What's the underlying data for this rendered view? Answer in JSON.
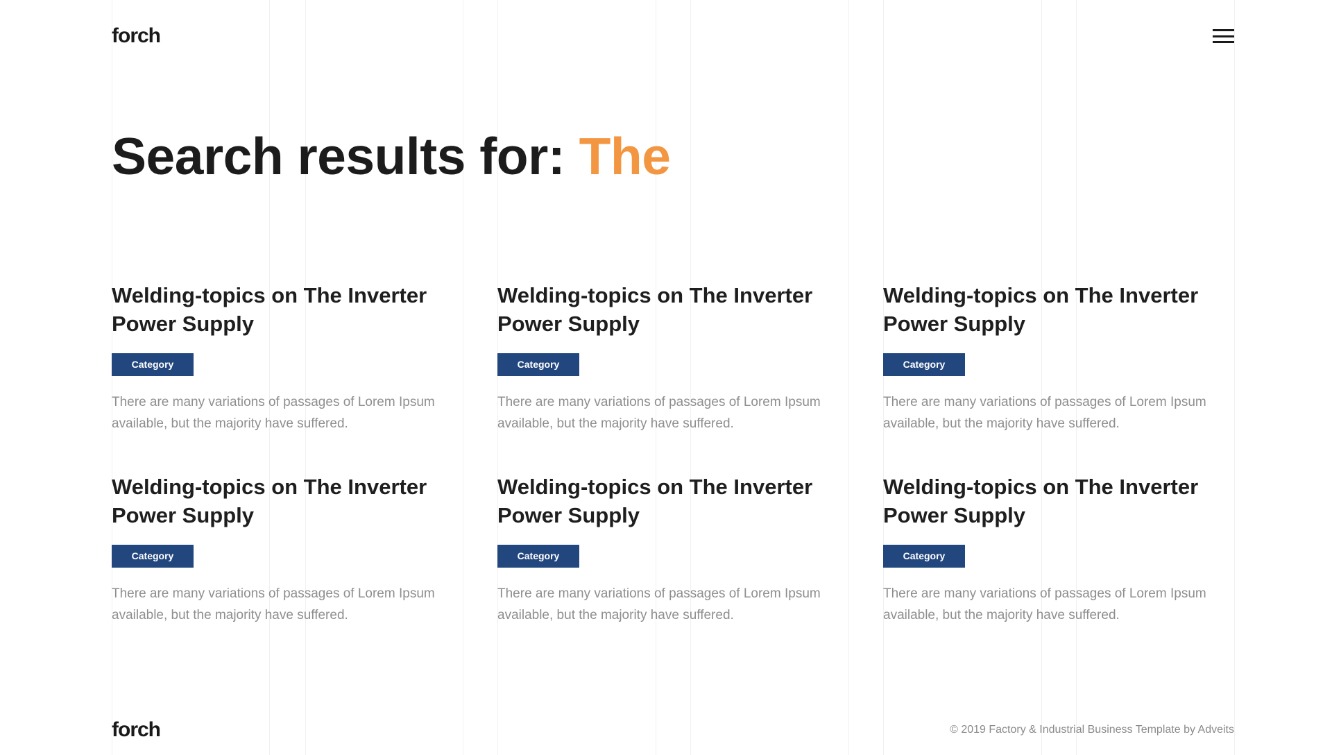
{
  "header": {
    "logo": "forch",
    "menu_icon": "hamburger-menu-icon"
  },
  "search": {
    "prefix": "Search results for:",
    "query": "The",
    "query_color": "#f39642"
  },
  "results": [
    {
      "title": "Welding-topics on The Inverter Power Supply",
      "category": "Category",
      "excerpt": "There are many variations of passages of Lorem Ipsum available, but the majority have suffered."
    },
    {
      "title": "Welding-topics on The Inverter Power Supply",
      "category": "Category",
      "excerpt": "There are many variations of passages of Lorem Ipsum available, but the majority have suffered."
    },
    {
      "title": "Welding-topics on The Inverter Power Supply",
      "category": "Category",
      "excerpt": "There are many variations of passages of Lorem Ipsum available, but the majority have suffered."
    },
    {
      "title": "Welding-topics on The Inverter Power Supply",
      "category": "Category",
      "excerpt": "There are many variations of passages of Lorem Ipsum available, but the majority have suffered."
    },
    {
      "title": "Welding-topics on The Inverter Power Supply",
      "category": "Category",
      "excerpt": "There are many variations of passages of Lorem Ipsum available, but the majority have suffered."
    },
    {
      "title": "Welding-topics on The Inverter Power Supply",
      "category": "Category",
      "excerpt": "There are many variations of passages of Lorem Ipsum available, but the majority have suffered."
    }
  ],
  "footer": {
    "logo": "forch",
    "copyright": "© 2019 Factory & Industrial Business Template by Adveits"
  },
  "colors": {
    "badge_bg": "#22467e",
    "accent": "#f39642",
    "heading": "#1c1c1c",
    "body_text": "#8e8e8e"
  }
}
